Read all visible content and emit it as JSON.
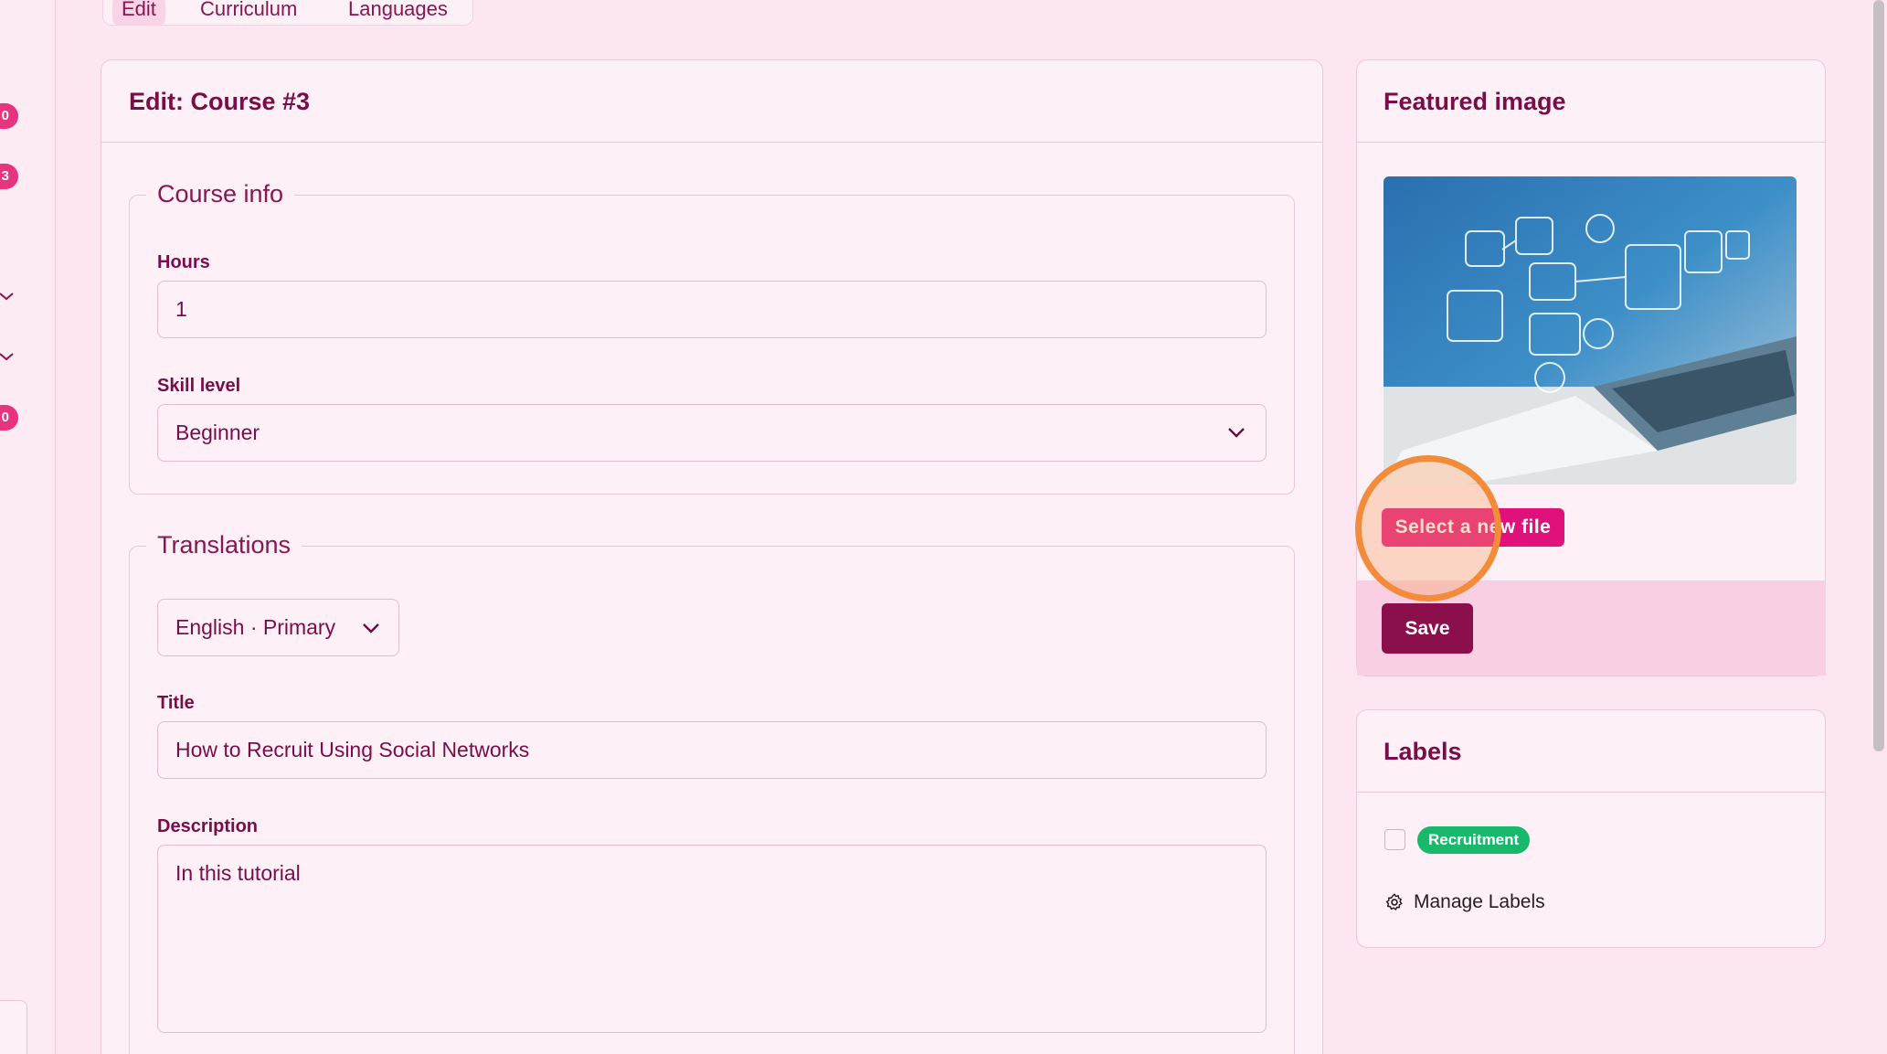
{
  "rail": {
    "badges": [
      "0",
      "3",
      "0"
    ]
  },
  "tabs": [
    {
      "label": "Edit",
      "active": true
    },
    {
      "label": "Curriculum",
      "active": false
    },
    {
      "label": "Languages",
      "active": false
    }
  ],
  "main": {
    "title": "Edit: Course #3",
    "course_info": {
      "legend": "Course info",
      "hours_label": "Hours",
      "hours_value": "1",
      "skill_label": "Skill level",
      "skill_value": "Beginner"
    },
    "translations": {
      "legend": "Translations",
      "language_value": "English · Primary",
      "title_label": "Title",
      "title_value": "How to Recruit Using Social Networks",
      "description_label": "Description",
      "description_value": "In this tutorial"
    }
  },
  "featured": {
    "title": "Featured image",
    "select_button": "Select a new file",
    "save_button": "Save"
  },
  "labels": {
    "title": "Labels",
    "items": [
      {
        "name": "Recruitment",
        "color": "#18b96d",
        "checked": false
      }
    ],
    "manage": "Manage Labels"
  },
  "colors": {
    "accent": "#e0117a",
    "primary_dark": "#8a0f4b",
    "text": "#7a0d47",
    "background": "#fce6f1"
  }
}
